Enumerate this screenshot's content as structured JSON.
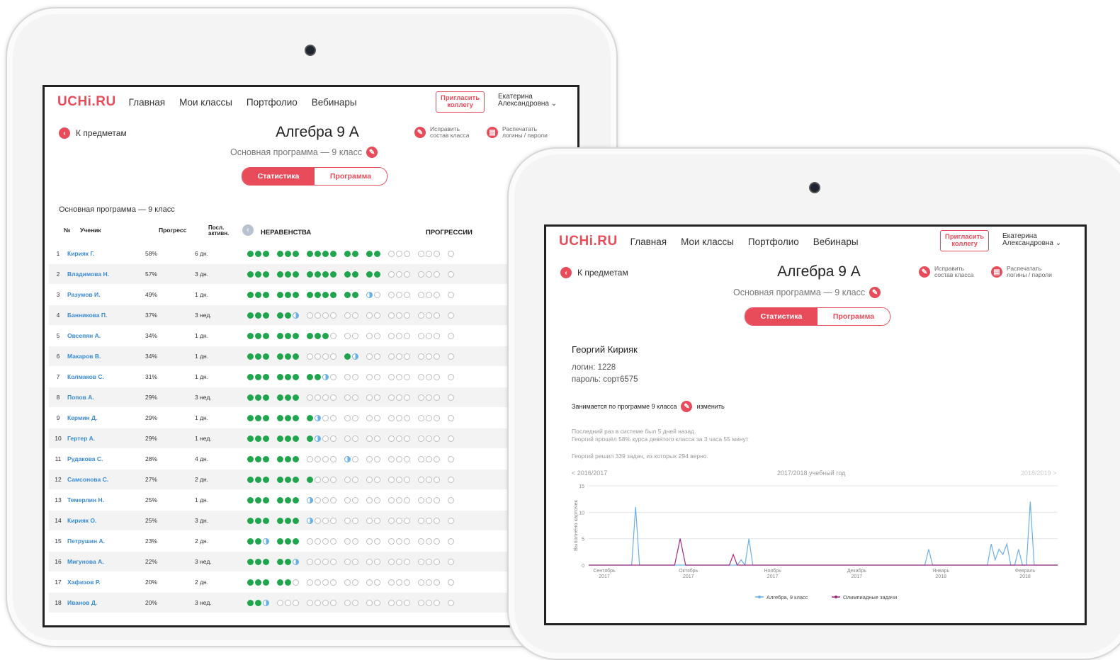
{
  "app": {
    "logo": "UCHi.RU",
    "nav": [
      "Главная",
      "Мои классы",
      "Портфолио",
      "Вебинары"
    ],
    "invite": [
      "Пригласить",
      "коллегу"
    ],
    "user": [
      "Екатерина",
      "Александровна ⌄"
    ],
    "back": "К предметам",
    "title": "Алгебра  9 А",
    "subtitle": "Основная программа — 9 класс",
    "action_fix": [
      "Исправить",
      "состав класса"
    ],
    "action_print": [
      "Распечатать",
      "логины / пароли"
    ],
    "tab_stats": "Статистика",
    "tab_program": "Программа"
  },
  "left": {
    "section_title": "Основная программа — 9 класс",
    "headers": {
      "num": "№",
      "name": "Ученик",
      "progress": "Прогресс",
      "activity": [
        "Посл.",
        "активн."
      ],
      "topic1": "НЕРАВЕНСТВА",
      "topic2": "ПРОГРЕССИИ"
    },
    "rows": [
      {
        "n": "1",
        "name": "Кирияк Г.",
        "progress": "58%",
        "activity": "6 дн.",
        "dots": "fff fff ffff ff ff eee eee e"
      },
      {
        "n": "2",
        "name": "Владимова Н.",
        "progress": "57%",
        "activity": "3 дн.",
        "dots": "fff fff ffff ff ff eee eee e"
      },
      {
        "n": "3",
        "name": "Разумов И.",
        "progress": "49%",
        "activity": "1 дн.",
        "dots": "fff fff ffff ff he eee eee e"
      },
      {
        "n": "4",
        "name": "Банникова П.",
        "progress": "37%",
        "activity": "3 нед.",
        "dots": "fff ffh eeee ee ee eee eee e"
      },
      {
        "n": "5",
        "name": "Овсепян А.",
        "progress": "34%",
        "activity": "1 дн.",
        "dots": "fff fff fffe ee ee eee eee e"
      },
      {
        "n": "6",
        "name": "Макаров В.",
        "progress": "34%",
        "activity": "1 дн.",
        "dots": "fff fff eeee fh ee eee eee e"
      },
      {
        "n": "7",
        "name": "Колмаков С.",
        "progress": "31%",
        "activity": "1 дн.",
        "dots": "fff fff ffhe ee ee eee eee e"
      },
      {
        "n": "8",
        "name": "Попов А.",
        "progress": "29%",
        "activity": "3 нед.",
        "dots": "fff fff eeee ee ee eee eee e"
      },
      {
        "n": "9",
        "name": "Кермин Д.",
        "progress": "29%",
        "activity": "1 дн.",
        "dots": "fff fff fhee ee ee eee eee e"
      },
      {
        "n": "10",
        "name": "Гертер А.",
        "progress": "29%",
        "activity": "1 нед.",
        "dots": "fff fff fhee ee ee eee eee e"
      },
      {
        "n": "11",
        "name": "Рудакова С.",
        "progress": "28%",
        "activity": "4 дн.",
        "dots": "fff fff eeee he ee eee eee e"
      },
      {
        "n": "12",
        "name": "Самсонова С.",
        "progress": "27%",
        "activity": "2 дн.",
        "dots": "fff fff feee ee ee eee eee e"
      },
      {
        "n": "13",
        "name": "Темерлин Н.",
        "progress": "25%",
        "activity": "1 дн.",
        "dots": "fff fff heee ee ee eee eee e"
      },
      {
        "n": "14",
        "name": "Кирияк О.",
        "progress": "25%",
        "activity": "3 дн.",
        "dots": "fff fff heee ee ee eee eee e"
      },
      {
        "n": "15",
        "name": "Петрушин А.",
        "progress": "23%",
        "activity": "2 дн.",
        "dots": "ffh fff eeee ee ee eee eee e"
      },
      {
        "n": "16",
        "name": "Мигунова А.",
        "progress": "22%",
        "activity": "3 нед.",
        "dots": "fff ffh eeee ee ee eee eee e"
      },
      {
        "n": "17",
        "name": "Хафизов Р.",
        "progress": "20%",
        "activity": "2 дн.",
        "dots": "fff ffe eeee ee ee eee eee e"
      },
      {
        "n": "18",
        "name": "Иванов Д.",
        "progress": "20%",
        "activity": "3 нед.",
        "dots": "ffh eee eeee ee ee eee eee e"
      }
    ]
  },
  "right": {
    "student_name": "Георгий Кирияк",
    "login": "логин: 1228",
    "password": "пароль: сорт6575",
    "program": "Занимается по программе 9 класса",
    "change": "изменить",
    "info1": "Последний раз в системе был 5 дней назад.",
    "info2": "Георгий прошёл 58% курса девятого класса за 3 часа 55 минут",
    "info3": "Георгий решил 339 задач, из которых 294 верно.",
    "prev_year": "< 2016/2017",
    "cur_year": "2017/2018 учебный год",
    "next_year": "2018/2019 >"
  },
  "chart_data": {
    "type": "line",
    "ylabel": "Выполнено карточек",
    "ylim": [
      0,
      15
    ],
    "yticks": [
      0,
      5,
      10,
      15
    ],
    "xticks": [
      "Сентябрь\n2017",
      "Октябрь\n2017",
      "Ноябрь\n2017",
      "Декабрь\n2017",
      "Январь\n2018",
      "Февраль\n2018"
    ],
    "xlim": [
      0,
      6
    ],
    "series": [
      {
        "name": "Алгебра, 9 класс",
        "color": "#6ab0e6",
        "x": [
          0.0,
          0.55,
          0.6,
          0.65,
          1.9,
          1.95,
          2.0,
          2.05,
          2.1,
          4.3,
          4.35,
          4.4,
          5.1,
          5.15,
          5.2,
          5.25,
          5.3,
          5.35,
          5.4,
          5.45,
          5.5,
          5.55,
          5.6,
          5.65,
          5.7,
          5.75,
          5.8,
          5.85,
          6.0
        ],
        "y": [
          0,
          0,
          11,
          0,
          0,
          1,
          0,
          5,
          0,
          0,
          3,
          0,
          0,
          4,
          1,
          3,
          2,
          4,
          0,
          0,
          3,
          0,
          0,
          12,
          0,
          0,
          0,
          0,
          0
        ]
      },
      {
        "name": "Олимпиадные задачи",
        "color": "#a0297e",
        "x": [
          0.0,
          1.1,
          1.17,
          1.24,
          1.8,
          1.85,
          1.9,
          6.0
        ],
        "y": [
          0,
          0,
          5,
          0,
          0,
          2,
          0,
          0
        ]
      }
    ],
    "legend": "bottom"
  }
}
